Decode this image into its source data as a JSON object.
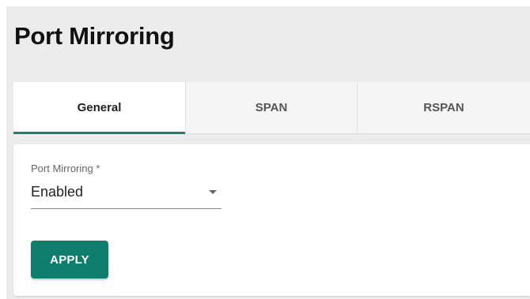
{
  "page": {
    "title": "Port Mirroring"
  },
  "tabs": [
    {
      "label": "General",
      "active": true
    },
    {
      "label": "SPAN",
      "active": false
    },
    {
      "label": "RSPAN",
      "active": false
    }
  ],
  "form": {
    "port_mirroring": {
      "label": "Port Mirroring *",
      "value": "Enabled"
    },
    "apply_label": "APPLY"
  },
  "colors": {
    "accent": "#1b7f72",
    "button": "#0f7d6d"
  }
}
